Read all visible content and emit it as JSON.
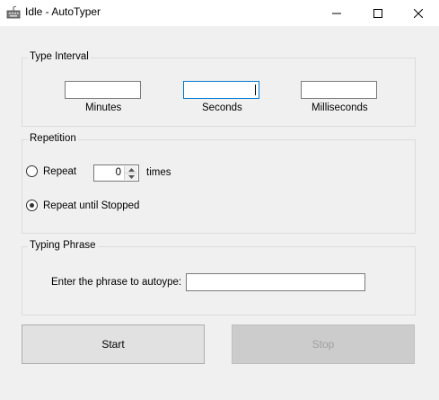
{
  "window": {
    "title": "Idle - AutoTyper",
    "controls": {
      "minimize": "minimize-icon",
      "maximize": "maximize-icon",
      "close": "close-icon"
    }
  },
  "type_interval": {
    "title": "Type Interval",
    "minutes": {
      "label": "Minutes",
      "value": ""
    },
    "seconds": {
      "label": "Seconds",
      "value": ""
    },
    "milliseconds": {
      "label": "Milliseconds",
      "value": ""
    }
  },
  "repetition": {
    "title": "Repetition",
    "repeat": {
      "label": "Repeat",
      "selected": false
    },
    "count": "0",
    "times_label": "times",
    "repeat_until_stopped": {
      "label": "Repeat until Stopped",
      "selected": true
    }
  },
  "typing_phrase": {
    "title": "Typing Phrase",
    "prompt": "Enter the phrase to autoype:",
    "value": ""
  },
  "buttons": {
    "start": "Start",
    "stop": "Stop"
  }
}
